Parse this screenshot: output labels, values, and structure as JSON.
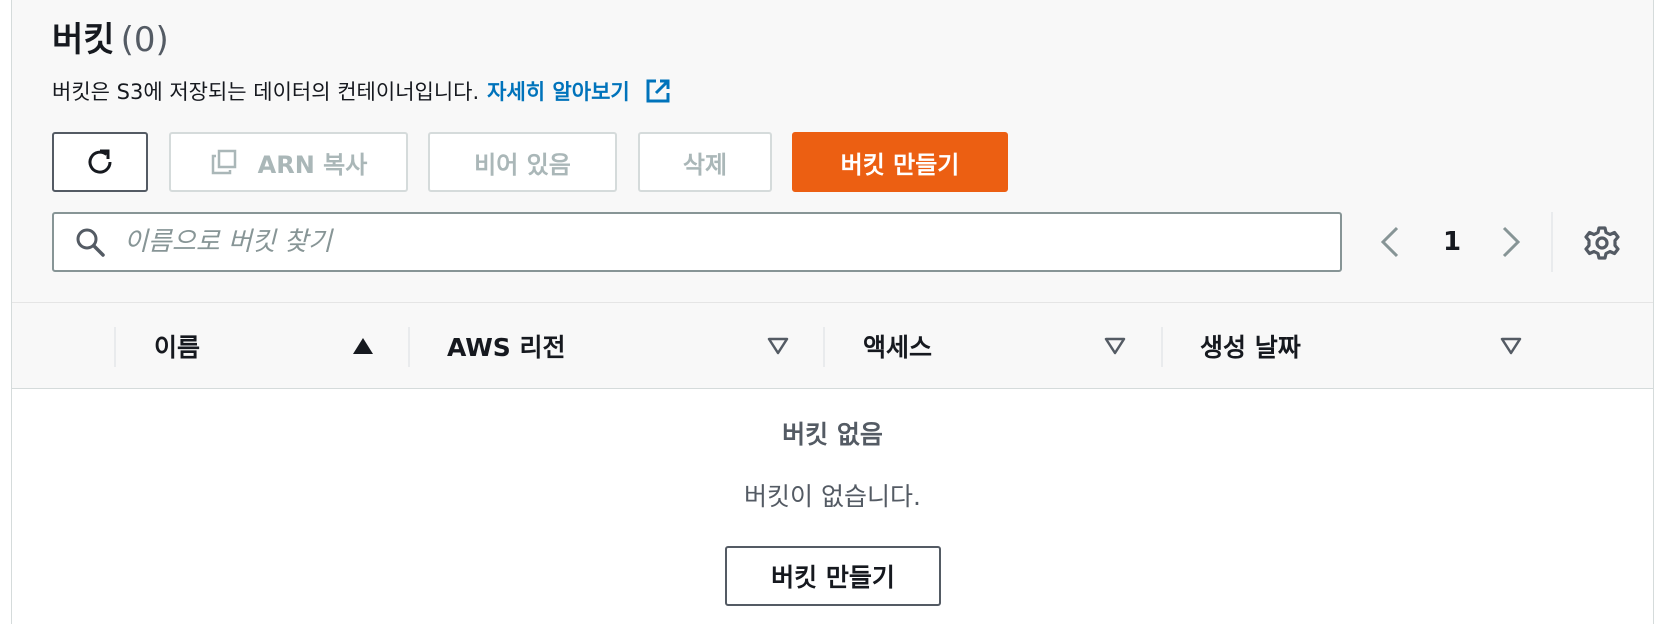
{
  "header": {
    "title": "버킷",
    "count": "(0)",
    "description": "버킷은 S3에 저장되는 데이터의 컨테이너입니다.",
    "learn_more_link": "자세히 알아보기"
  },
  "toolbar": {
    "refresh_icon": "refresh-icon",
    "copy_arn_label": "ARN 복사",
    "empty_label": "비어 있음",
    "delete_label": "삭제",
    "create_label": "버킷 만들기"
  },
  "search": {
    "placeholder": "이름으로 버킷 찾기",
    "value": ""
  },
  "pagination": {
    "current_page": "1"
  },
  "table": {
    "columns": [
      {
        "label": "이름",
        "sort": "ascending"
      },
      {
        "label": "AWS 리전",
        "sort": "none"
      },
      {
        "label": "액세스",
        "sort": "none"
      },
      {
        "label": "생성 날짜",
        "sort": "none"
      }
    ],
    "empty_title": "버킷 없음",
    "empty_description": "버킷이 없습니다.",
    "empty_create_label": "버킷 만들기"
  },
  "colors": {
    "primary": "#ec5f12",
    "link": "#0073bb",
    "text": "#16191f",
    "muted": "#545b64",
    "disabled": "#aab7b8"
  }
}
